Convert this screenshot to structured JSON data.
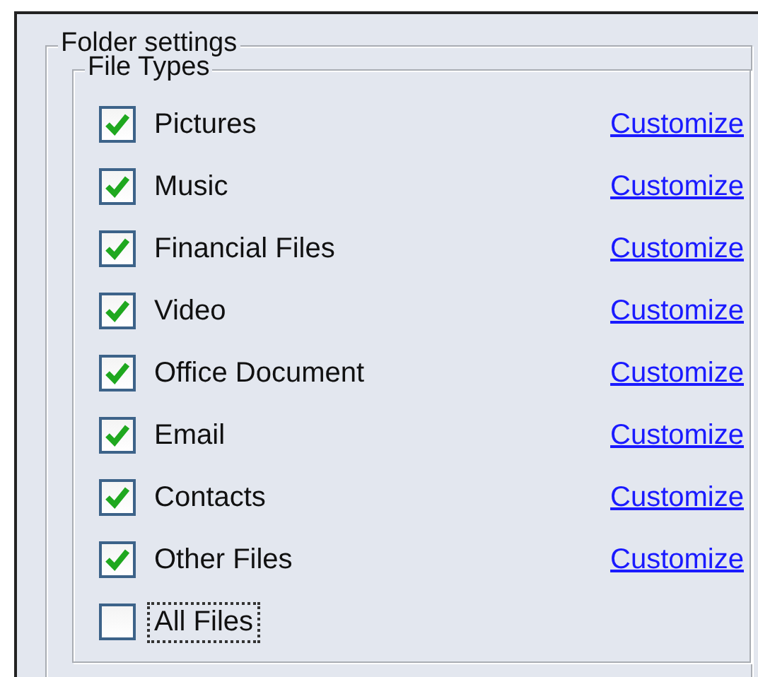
{
  "folder_settings": {
    "title": "Folder settings"
  },
  "file_types": {
    "title": "File Types",
    "items": [
      {
        "label": "Pictures",
        "checked": true,
        "focused": false,
        "link": "Customize"
      },
      {
        "label": "Music",
        "checked": true,
        "focused": false,
        "link": "Customize"
      },
      {
        "label": "Financial Files",
        "checked": true,
        "focused": false,
        "link": "Customize"
      },
      {
        "label": "Video",
        "checked": true,
        "focused": false,
        "link": "Customize"
      },
      {
        "label": "Office Document",
        "checked": true,
        "focused": false,
        "link": "Customize"
      },
      {
        "label": "Email",
        "checked": true,
        "focused": false,
        "link": "Customize"
      },
      {
        "label": "Contacts",
        "checked": true,
        "focused": false,
        "link": "Customize"
      },
      {
        "label": "Other Files",
        "checked": true,
        "focused": false,
        "link": "Customize"
      },
      {
        "label": "All Files",
        "checked": false,
        "focused": true
      }
    ]
  }
}
